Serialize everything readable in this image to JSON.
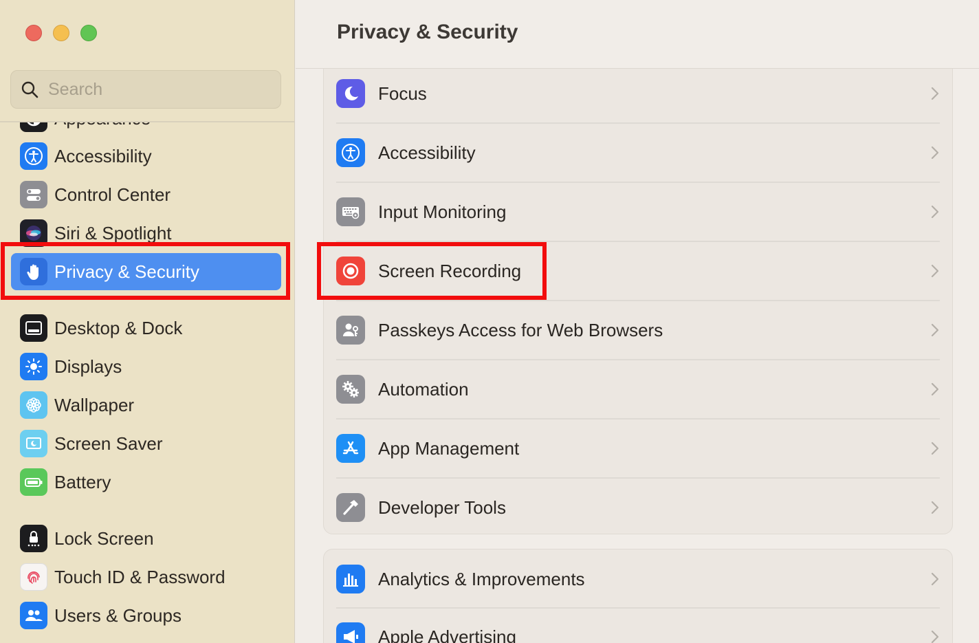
{
  "window": {
    "title": "Privacy & Security"
  },
  "colors": {
    "sidebar_bg": "#ebe2c6",
    "selection": "#4e8ff0",
    "highlight": "#f20d0d",
    "main_bg": "#f1ede8"
  },
  "sidebar": {
    "search_placeholder": "Search",
    "items": [
      {
        "label": "Appearance",
        "icon": "appearance-icon"
      },
      {
        "label": "Accessibility",
        "icon": "accessibility-icon"
      },
      {
        "label": "Control Center",
        "icon": "control-center-icon"
      },
      {
        "label": "Siri & Spotlight",
        "icon": "siri-icon"
      },
      {
        "label": "Privacy & Security",
        "icon": "privacy-hand-icon",
        "selected": true
      },
      {
        "label": "Desktop & Dock",
        "icon": "desktop-dock-icon"
      },
      {
        "label": "Displays",
        "icon": "displays-icon"
      },
      {
        "label": "Wallpaper",
        "icon": "wallpaper-icon"
      },
      {
        "label": "Screen Saver",
        "icon": "screen-saver-icon"
      },
      {
        "label": "Battery",
        "icon": "battery-icon"
      },
      {
        "label": "Lock Screen",
        "icon": "lock-screen-icon"
      },
      {
        "label": "Touch ID & Password",
        "icon": "fingerprint-icon"
      },
      {
        "label": "Users & Groups",
        "icon": "users-groups-icon"
      }
    ]
  },
  "main": {
    "title": "Privacy & Security",
    "permissions": [
      {
        "label": "Focus",
        "icon": "focus-moon-icon"
      },
      {
        "label": "Accessibility",
        "icon": "accessibility-icon"
      },
      {
        "label": "Input Monitoring",
        "icon": "keyboard-icon"
      },
      {
        "label": "Screen Recording",
        "icon": "screen-recording-icon",
        "highlighted": true
      },
      {
        "label": "Passkeys Access for Web Browsers",
        "icon": "passkeys-icon"
      },
      {
        "label": "Automation",
        "icon": "gears-icon"
      },
      {
        "label": "App Management",
        "icon": "app-store-icon"
      },
      {
        "label": "Developer Tools",
        "icon": "hammer-icon"
      }
    ],
    "analytics": [
      {
        "label": "Analytics & Improvements",
        "icon": "analytics-bars-icon"
      },
      {
        "label": "Apple Advertising",
        "icon": "megaphone-icon"
      }
    ]
  }
}
